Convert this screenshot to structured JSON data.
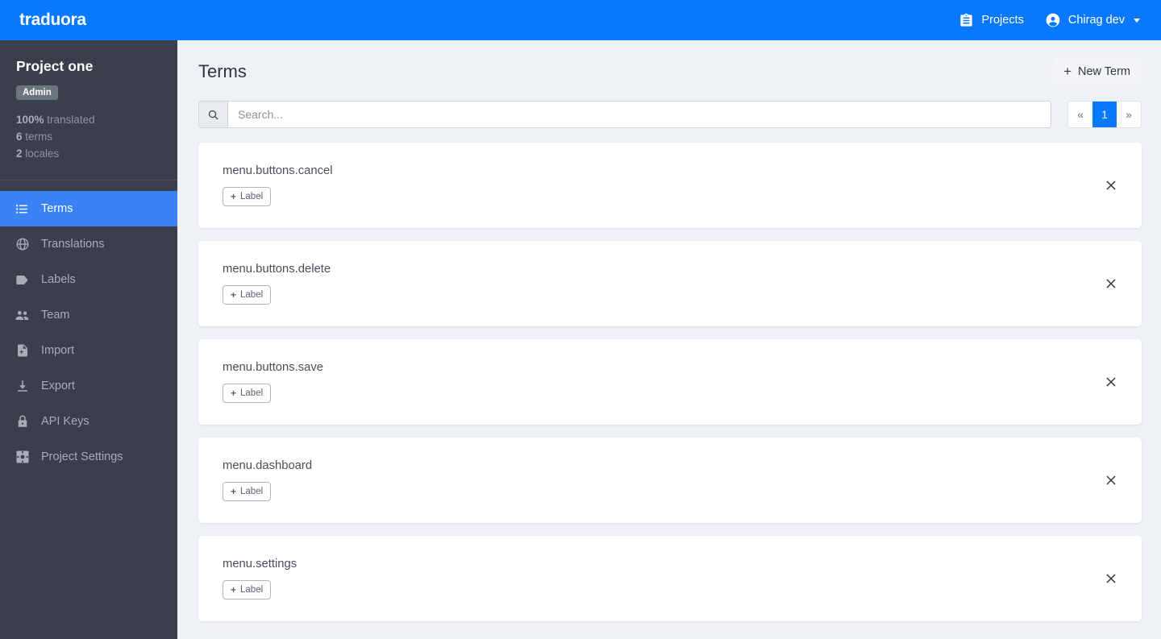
{
  "navbar": {
    "brand": "traduora",
    "projects_label": "Projects",
    "projects_icon": "clipboard-icon",
    "user_label": "Chirag dev",
    "user_icon": "account-circle-icon",
    "caret_icon": "caret-down-icon",
    "background_color": "#0878ff"
  },
  "sidebar": {
    "project_title": "Project one",
    "role_badge": "Admin",
    "stats": [
      {
        "value": "100%",
        "label": "translated"
      },
      {
        "value": "6",
        "label": "terms"
      },
      {
        "value": "2",
        "label": "locales"
      }
    ],
    "background_color": "#3a3f4b",
    "active_color": "#3b82f6",
    "items": [
      {
        "label": "Terms",
        "icon": "list-icon",
        "active": true
      },
      {
        "label": "Translations",
        "icon": "globe-icon",
        "active": false
      },
      {
        "label": "Labels",
        "icon": "tag-icon",
        "active": false
      },
      {
        "label": "Team",
        "icon": "people-icon",
        "active": false
      },
      {
        "label": "Import",
        "icon": "file-add-icon",
        "active": false
      },
      {
        "label": "Export",
        "icon": "download-icon",
        "active": false
      },
      {
        "label": "API Keys",
        "icon": "lock-icon",
        "active": false
      },
      {
        "label": "Project Settings",
        "icon": "gear-icon",
        "active": false
      }
    ]
  },
  "main": {
    "page_title": "Terms",
    "new_term_label": "New Term",
    "new_term_icon": "plus-icon",
    "search": {
      "placeholder": "Search...",
      "value": "",
      "icon": "search-icon"
    },
    "pagination": {
      "prev": "«",
      "next": "»",
      "pages": [
        "1"
      ],
      "current": "1",
      "active_color": "#0878ff"
    },
    "label_button": "Label",
    "label_button_icon": "plus-icon",
    "close_icon": "close-icon",
    "terms": [
      {
        "name": "menu.buttons.cancel"
      },
      {
        "name": "menu.buttons.delete"
      },
      {
        "name": "menu.buttons.save"
      },
      {
        "name": "menu.dashboard"
      },
      {
        "name": "menu.settings"
      }
    ]
  }
}
